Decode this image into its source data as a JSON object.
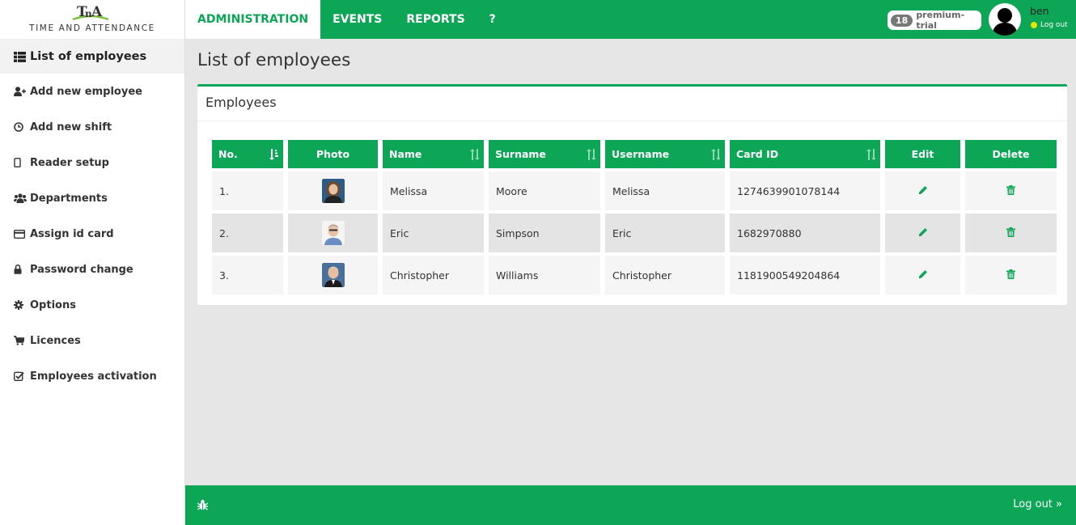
{
  "logo": {
    "mark": "TnA",
    "tagline": "TIME AND ATTENDANCE"
  },
  "sidebar": {
    "items": [
      {
        "label": "List of employees",
        "icon": "list-icon",
        "active": true
      },
      {
        "label": "Add new employee",
        "icon": "user-plus-icon"
      },
      {
        "label": "Add new shift",
        "icon": "clock-icon"
      },
      {
        "label": "Reader setup",
        "icon": "tablet-icon"
      },
      {
        "label": "Departments",
        "icon": "users-icon"
      },
      {
        "label": "Assign id card",
        "icon": "credit-card-icon"
      },
      {
        "label": "Password change",
        "icon": "lock-icon"
      },
      {
        "label": "Options",
        "icon": "gear-icon"
      },
      {
        "label": "Licences",
        "icon": "cart-icon"
      },
      {
        "label": "Employees activation",
        "icon": "checkbox-icon"
      }
    ]
  },
  "topbar": {
    "tabs": [
      {
        "label": "ADMINISTRATION",
        "active": true
      },
      {
        "label": "EVENTS"
      },
      {
        "label": "REPORTS"
      },
      {
        "label": "?"
      }
    ],
    "badge_count": "18",
    "badge_label": "premium-trial",
    "user": "ben",
    "logout": "Log out"
  },
  "page": {
    "title": "List of employees",
    "panel_title": "Employees"
  },
  "table": {
    "headers": [
      "No.",
      "Photo",
      "Name",
      "Surname",
      "Username",
      "Card ID",
      "Edit",
      "Delete"
    ],
    "rows": [
      {
        "no": "1.",
        "name": "Melissa",
        "surname": "Moore",
        "username": "Melissa",
        "card_id": "1274639901078144"
      },
      {
        "no": "2.",
        "name": "Eric",
        "surname": "Simpson",
        "username": "Eric",
        "card_id": "1682970880"
      },
      {
        "no": "3.",
        "name": "Christopher",
        "surname": "Williams",
        "username": "Christopher",
        "card_id": "1181900549204864"
      }
    ]
  },
  "footer": {
    "logout": "Log out »"
  },
  "colors": {
    "accent": "#0ca656",
    "status_dot": "#e6e600"
  }
}
